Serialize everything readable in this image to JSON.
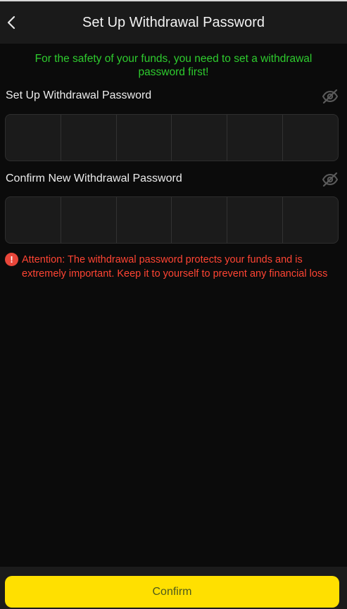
{
  "header": {
    "title": "Set Up Withdrawal Password",
    "back_icon": "chevron-left-icon"
  },
  "notice": "For the safety of your funds, you need to set a withdrawal password first!",
  "password": {
    "label": "Set Up Withdrawal Password",
    "toggle_icon": "eye-off-icon",
    "digits": 6
  },
  "confirm_password": {
    "label": "Confirm New Withdrawal Password",
    "toggle_icon": "eye-off-icon",
    "digits": 6
  },
  "attention": {
    "icon": "exclamation-circle-icon",
    "text": "Attention: The withdrawal password protects your funds and is extremely important. Keep it to yourself to prevent any financial loss"
  },
  "confirm_button": "Confirm",
  "colors": {
    "accent": "#ffe000",
    "notice": "#2ecc2e",
    "warning": "#ff4433",
    "background": "#0b0b0b"
  }
}
